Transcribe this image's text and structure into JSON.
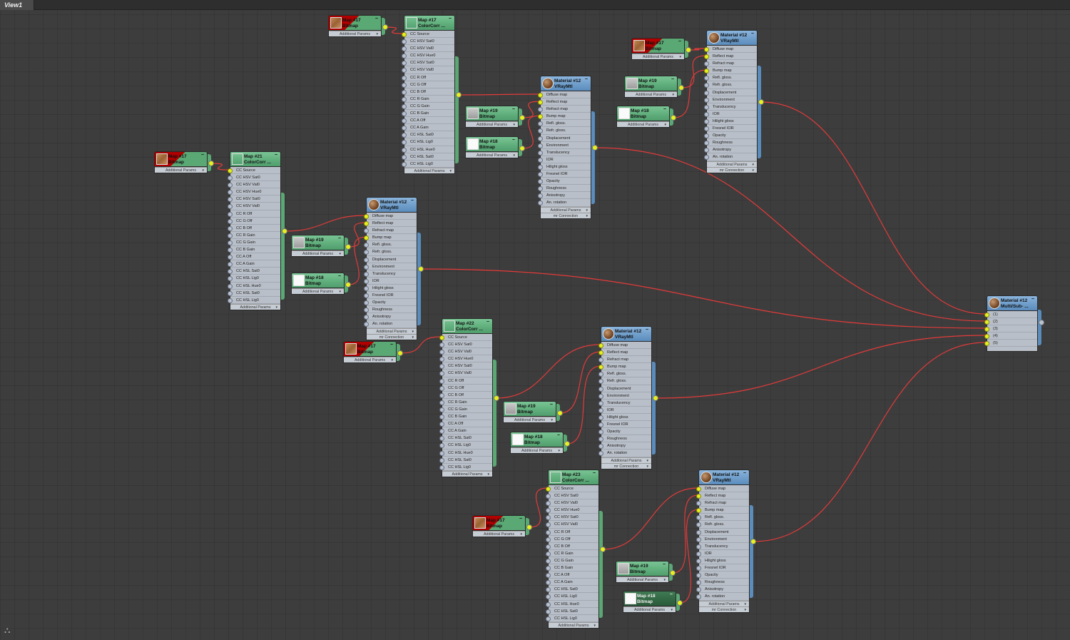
{
  "view_tab": "View1",
  "colors": {
    "wire": "#e33a3a",
    "port_connected": "#e6f21e",
    "material_header": "#6a9cc8",
    "map_header": "#5aa874"
  },
  "node_types": {
    "bitmap": {
      "footer": "Additional Params"
    },
    "colorcorrect": {
      "slots": [
        "CC Source",
        "CC HSV Sat0",
        "CC HSV Val0",
        "CC HSV Hue0",
        "CC HSV Sat0",
        "CC HSV Val0",
        "CC R Off",
        "CC G Off",
        "CC B Off",
        "CC R Gain",
        "CC G Gain",
        "CC B Gain",
        "CC A Off",
        "CC A Gain",
        "CC HSL Sat0",
        "CC HSL Lig0",
        "CC HSL Hue0",
        "CC HSL Sat0",
        "CC HSL Lig0"
      ],
      "footers": [
        "Additional Params"
      ]
    },
    "vraymtl": {
      "slots": [
        "Diffuse map",
        "Reflect map",
        "Refract map",
        "Bump map",
        "Refl. gloss.",
        "Refr. gloss.",
        "Displacement",
        "Environment",
        "Translucency",
        "IOR",
        "Hilight gloss",
        "Fresnel IOR",
        "Opacity",
        "Roughness",
        "Anisotropy",
        "An. rotation"
      ],
      "footers": [
        "Additional Params",
        "mr Connection"
      ]
    },
    "multisub": {
      "slots": [
        "(1)",
        "(2)",
        "(3)",
        "(4)",
        "(5)"
      ],
      "footers": []
    }
  },
  "nodes": [
    {
      "kind": "bitmap",
      "title": "Map #17",
      "subtitle": "Bitmap",
      "thumb": "wood",
      "style": "red"
    },
    {
      "kind": "colorcorrect",
      "title": "Map #17",
      "subtitle": "ColorCorr ..."
    },
    {
      "kind": "bitmap",
      "title": "Map #19",
      "subtitle": "Bitmap",
      "thumb": "gray"
    },
    {
      "kind": "bitmap",
      "title": "Map #18",
      "subtitle": "Bitmap",
      "thumb": "white"
    },
    {
      "kind": "vraymtl",
      "title": "Material #12",
      "subtitle": "VRayMtl"
    },
    {
      "kind": "bitmap",
      "title": "Map #17",
      "subtitle": "Bitmap",
      "thumb": "wood",
      "style": "red"
    },
    {
      "kind": "bitmap",
      "title": "Map #19",
      "subtitle": "Bitmap",
      "thumb": "gray"
    },
    {
      "kind": "bitmap",
      "title": "Map #18",
      "subtitle": "Bitmap",
      "thumb": "white"
    },
    {
      "kind": "vraymtl",
      "title": "Material #12",
      "subtitle": "VRayMtl"
    },
    {
      "kind": "bitmap",
      "title": "Map #17",
      "subtitle": "Bitmap",
      "thumb": "wood",
      "style": "red"
    },
    {
      "kind": "colorcorrect",
      "title": "Map #21",
      "subtitle": "ColorCorr ..."
    },
    {
      "kind": "bitmap",
      "title": "Map #19",
      "subtitle": "Bitmap",
      "thumb": "gray"
    },
    {
      "kind": "bitmap",
      "title": "Map #18",
      "subtitle": "Bitmap",
      "thumb": "white"
    },
    {
      "kind": "vraymtl",
      "title": "Material #12",
      "subtitle": "VRayMtl"
    },
    {
      "kind": "bitmap",
      "title": "Map #17",
      "subtitle": "Bitmap",
      "thumb": "wood",
      "style": "red"
    },
    {
      "kind": "colorcorrect",
      "title": "Map #22",
      "subtitle": "ColorCorr ..."
    },
    {
      "kind": "bitmap",
      "title": "Map #19",
      "subtitle": "Bitmap",
      "thumb": "gray"
    },
    {
      "kind": "bitmap",
      "title": "Map #18",
      "subtitle": "Bitmap",
      "thumb": "white"
    },
    {
      "kind": "vraymtl",
      "title": "Material #12",
      "subtitle": "VRayMtl"
    },
    {
      "kind": "bitmap",
      "title": "Map #17",
      "subtitle": "Bitmap",
      "thumb": "wood",
      "style": "red"
    },
    {
      "kind": "colorcorrect",
      "title": "Map #23",
      "subtitle": "ColorCorr ..."
    },
    {
      "kind": "bitmap",
      "title": "Map #19",
      "subtitle": "Bitmap",
      "thumb": "gray"
    },
    {
      "kind": "bitmap",
      "title": "Map #18",
      "subtitle": "Bitmap",
      "thumb": "white",
      "style": "sel"
    },
    {
      "kind": "vraymtl",
      "title": "Material #12",
      "subtitle": "VRayMtl"
    },
    {
      "kind": "multisub",
      "title": "Material #12",
      "subtitle": "Multi/Sub- ..."
    }
  ],
  "connections": [
    {
      "from": 0,
      "to": 1,
      "slot": 0
    },
    {
      "from": 1,
      "to": 4,
      "slot": 0
    },
    {
      "from": 2,
      "to": 4,
      "slot": 1
    },
    {
      "from": 3,
      "to": 4,
      "slot": 3
    },
    {
      "from": 5,
      "to": 8,
      "slot": 0
    },
    {
      "from": 6,
      "to": 8,
      "slot": 1
    },
    {
      "from": 7,
      "to": 8,
      "slot": 3
    },
    {
      "from": 9,
      "to": 10,
      "slot": 0
    },
    {
      "from": 10,
      "to": 13,
      "slot": 0
    },
    {
      "from": 11,
      "to": 13,
      "slot": 1
    },
    {
      "from": 12,
      "to": 13,
      "slot": 3
    },
    {
      "from": 14,
      "to": 15,
      "slot": 0
    },
    {
      "from": 15,
      "to": 18,
      "slot": 0
    },
    {
      "from": 16,
      "to": 18,
      "slot": 1
    },
    {
      "from": 17,
      "to": 18,
      "slot": 3
    },
    {
      "from": 19,
      "to": 20,
      "slot": 0
    },
    {
      "from": 20,
      "to": 23,
      "slot": 0
    },
    {
      "from": 21,
      "to": 23,
      "slot": 1
    },
    {
      "from": 22,
      "to": 23,
      "slot": 3
    },
    {
      "from": 8,
      "to": 24,
      "slot": 0
    },
    {
      "from": 4,
      "to": 24,
      "slot": 1
    },
    {
      "from": 13,
      "to": 24,
      "slot": 2
    },
    {
      "from": 18,
      "to": 24,
      "slot": 3
    },
    {
      "from": 23,
      "to": 24,
      "slot": 4
    }
  ]
}
